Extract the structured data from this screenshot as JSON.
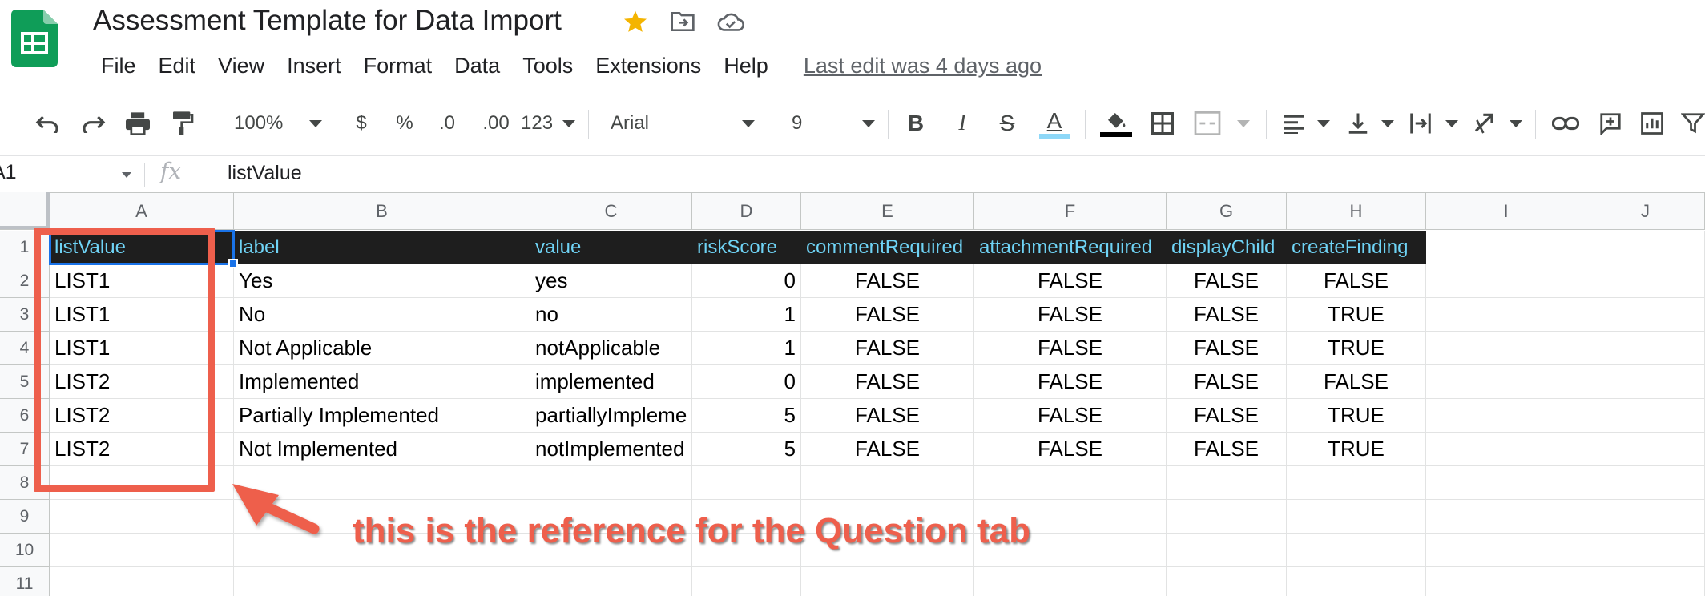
{
  "app": {
    "title": "Assessment Template for Data Import",
    "menu": [
      "File",
      "Edit",
      "View",
      "Insert",
      "Format",
      "Data",
      "Tools",
      "Extensions",
      "Help"
    ],
    "last_edit": "Last edit was 4 days ago"
  },
  "toolbar": {
    "zoom": "100%",
    "currency": "$",
    "percent": "%",
    "decrease_decimal": ".0",
    "increase_decimal": ".00",
    "number_format": "123",
    "font": "Arial",
    "font_size": "9",
    "bold": "B",
    "italic": "I",
    "strike": "S",
    "text_color": "A"
  },
  "formula_bar": {
    "name_box": "A1",
    "fx": "fx",
    "value": "listValue"
  },
  "sheet": {
    "columns": [
      "A",
      "B",
      "C",
      "D",
      "E",
      "F",
      "G",
      "H",
      "I",
      "J"
    ],
    "rows": [
      "1",
      "2",
      "3",
      "4",
      "5",
      "6",
      "7",
      "8",
      "9",
      "10",
      "11"
    ],
    "header": [
      "listValue",
      "label",
      "value",
      "riskScore",
      "commentRequired",
      "attachmentRequired",
      "displayChild",
      "createFinding"
    ],
    "data": [
      [
        "LIST1",
        "Yes",
        "yes",
        "0",
        "FALSE",
        "FALSE",
        "FALSE",
        "FALSE"
      ],
      [
        "LIST1",
        "No",
        "no",
        "1",
        "FALSE",
        "FALSE",
        "FALSE",
        "TRUE"
      ],
      [
        "LIST1",
        "Not Applicable",
        "notApplicable",
        "1",
        "FALSE",
        "FALSE",
        "FALSE",
        "TRUE"
      ],
      [
        "LIST2",
        "Implemented",
        "implemented",
        "0",
        "FALSE",
        "FALSE",
        "FALSE",
        "FALSE"
      ],
      [
        "LIST2",
        "Partially Implemented",
        "partiallyImpleme",
        "5",
        "FALSE",
        "FALSE",
        "FALSE",
        "TRUE"
      ],
      [
        "LIST2",
        "Not Implemented",
        "notImplemented",
        "5",
        "FALSE",
        "FALSE",
        "FALSE",
        "TRUE"
      ]
    ]
  },
  "annotation": {
    "text": "this is the reference for the Question tab",
    "color": "#ee5f4c"
  },
  "colors": {
    "header_bg": "#1e1e1e",
    "header_text": "#6fd3f5",
    "selection": "#1a73e8",
    "logo": "#0f9d58"
  }
}
